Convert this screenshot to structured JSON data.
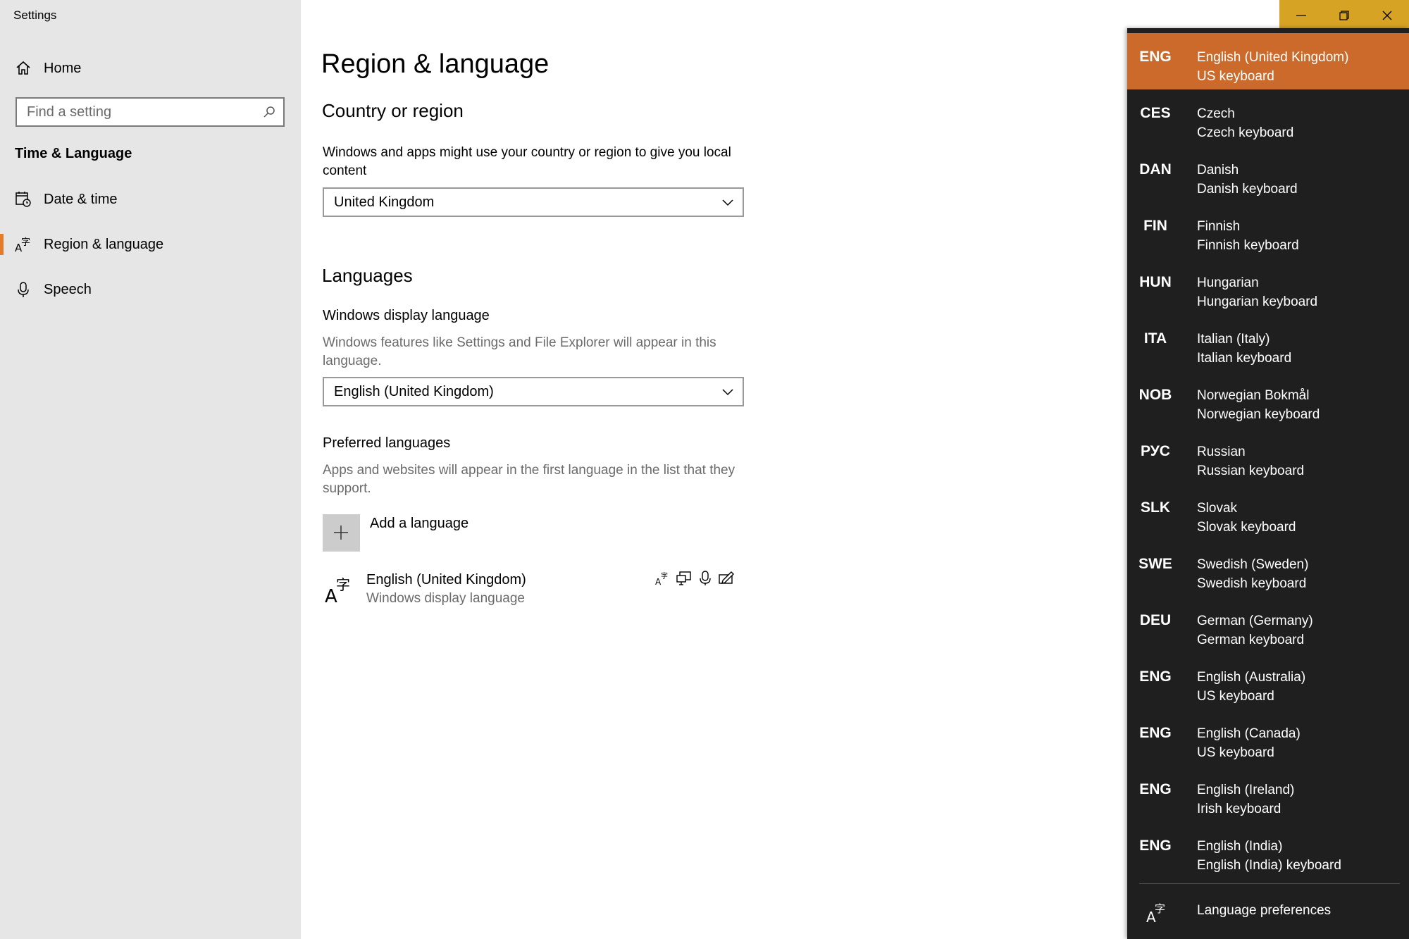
{
  "app": {
    "title": "Settings"
  },
  "sidebar": {
    "home_label": "Home",
    "search_placeholder": "Find a setting",
    "section_title": "Time & Language",
    "items": [
      {
        "label": "Date & time",
        "icon": "calendar-clock-icon"
      },
      {
        "label": "Region & language",
        "icon": "language-icon",
        "active": true
      },
      {
        "label": "Speech",
        "icon": "microphone-icon"
      }
    ]
  },
  "main": {
    "title": "Region & language",
    "country": {
      "heading": "Country or region",
      "description": "Windows and apps might use your country or region to give you local content",
      "selected": "United Kingdom"
    },
    "languages": {
      "heading": "Languages",
      "display_heading": "Windows display language",
      "display_description": "Windows features like Settings and File Explorer will appear in this language.",
      "display_selected": "English (United Kingdom)",
      "preferred_heading": "Preferred languages",
      "preferred_description": "Apps and websites will appear in the first language in the list that they support.",
      "add_label": "Add a language",
      "installed": [
        {
          "name": "English (United Kingdom)",
          "subtitle": "Windows display language",
          "features": [
            "language-pack-icon",
            "display-icon",
            "speech-icon",
            "handwriting-icon"
          ]
        }
      ]
    }
  },
  "flyout": {
    "items": [
      {
        "code": "ENG",
        "name": "English (United Kingdom)",
        "keyboard": "US keyboard",
        "selected": true
      },
      {
        "code": "CES",
        "name": "Czech",
        "keyboard": "Czech keyboard"
      },
      {
        "code": "DAN",
        "name": "Danish",
        "keyboard": "Danish keyboard"
      },
      {
        "code": "FIN",
        "name": "Finnish",
        "keyboard": "Finnish keyboard"
      },
      {
        "code": "HUN",
        "name": "Hungarian",
        "keyboard": "Hungarian keyboard"
      },
      {
        "code": "ITA",
        "name": "Italian (Italy)",
        "keyboard": "Italian keyboard"
      },
      {
        "code": "NOB",
        "name": "Norwegian Bokmål",
        "keyboard": "Norwegian keyboard"
      },
      {
        "code": "РУС",
        "name": "Russian",
        "keyboard": "Russian keyboard"
      },
      {
        "code": "SLK",
        "name": "Slovak",
        "keyboard": "Slovak keyboard"
      },
      {
        "code": "SWE",
        "name": "Swedish (Sweden)",
        "keyboard": "Swedish keyboard"
      },
      {
        "code": "DEU",
        "name": "German (Germany)",
        "keyboard": "German keyboard"
      },
      {
        "code": "ENG",
        "name": "English (Australia)",
        "keyboard": "US keyboard"
      },
      {
        "code": "ENG",
        "name": "English (Canada)",
        "keyboard": "US keyboard"
      },
      {
        "code": "ENG",
        "name": "English (Ireland)",
        "keyboard": "Irish keyboard"
      },
      {
        "code": "ENG",
        "name": "English (India)",
        "keyboard": "English (India) keyboard"
      }
    ],
    "preferences_label": "Language preferences"
  },
  "colors": {
    "accent": "#e37b2b",
    "flyout_selected": "#cc6a2c",
    "flyout_bg": "#1f1f1f",
    "titlebar_buttons": "#d7a324",
    "sidebar_bg": "#e6e6e6"
  }
}
